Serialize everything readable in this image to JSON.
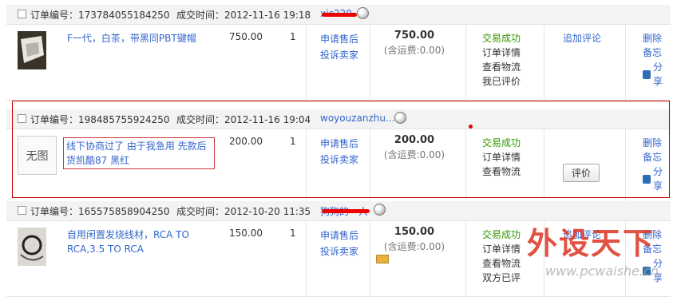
{
  "labels": {
    "order_no": "订单编号：",
    "time": "成交时间：",
    "service": "申请售后",
    "complain": "投诉卖家",
    "shipping_note": "(含运费:0.00)",
    "delete": "删除",
    "memo": "备忘",
    "share": "分享",
    "no_image": "无图"
  },
  "orders": [
    {
      "order_no": "173784055184250",
      "time": "2012-11-16 19:18",
      "seller": "xic220",
      "title": "F一代，白茶，带黑同PBT键帽",
      "price": "750.00",
      "qty": "1",
      "total": "750.00",
      "statuses": [
        "交易成功",
        "订单详情",
        "查看物流",
        "我已评价"
      ],
      "action": "追加评论"
    },
    {
      "order_no": "198485755924250",
      "time": "2012-11-16 19:04",
      "seller": "woyouzanzhu...",
      "title": "线下协商过了 由于我急用 先款后货凯酷87 黑红",
      "price": "200.00",
      "qty": "1",
      "total": "200.00",
      "statuses": [
        "交易成功",
        "订单详情",
        "查看物流"
      ],
      "action": "评价"
    },
    {
      "order_no": "165575858904250",
      "time": "2012-10-20 11:35",
      "seller": "狗狗的一人",
      "title": "自用闲置发烧线材，RCA TO RCA,3.5 TO RCA",
      "price": "150.00",
      "qty": "1",
      "total": "150.00",
      "statuses": [
        "交易成功",
        "订单详情",
        "查看物流",
        "双方已评"
      ],
      "action": "追加评论"
    }
  ],
  "watermark": {
    "brand": "外设天下",
    "url": "www.pcwaishe.cn"
  },
  "colors": {
    "link": "#3366cc",
    "success": "#339900",
    "highlight": "#cc0000"
  }
}
